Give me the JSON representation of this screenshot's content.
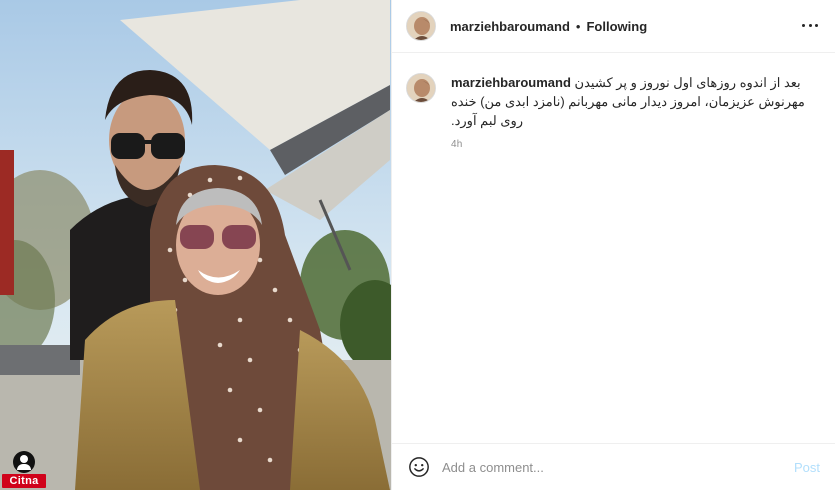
{
  "post": {
    "username": "marziehbaroumand",
    "separator": "•",
    "follow_status": "Following",
    "more_icon": "more-horizontal-icon",
    "caption": {
      "username": "marziehbaroumand",
      "text": "بعد از اندوه روزهای اول نوروز و پر کشیدن مهرنوش عزیزمان، امروز دیدار مانی مهربانم (نامزد ابدی من) خنده روی لبم آورد.",
      "time_ago": "4h"
    },
    "add_comment": {
      "placeholder": "Add a comment...",
      "post_label": "Post",
      "emoji_icon": "smiley-icon"
    },
    "watermark": {
      "text": "Citna"
    }
  },
  "colors": {
    "link_disabled": "#b2dffc",
    "secondary_text": "#8e8e8e",
    "border": "#efefef",
    "watermark_red": "#d0021b"
  }
}
